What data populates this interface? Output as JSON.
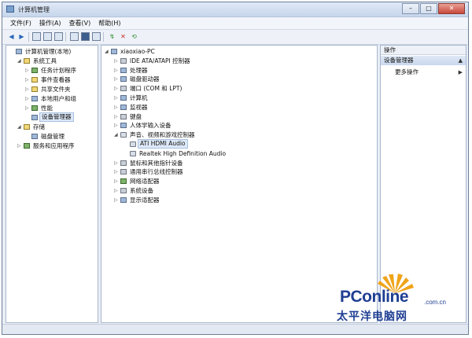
{
  "window": {
    "title": "计算机管理",
    "buttons": {
      "minimize": "–",
      "maximize": "□",
      "close": "✕"
    }
  },
  "menu": [
    "文件(F)",
    "操作(A)",
    "查看(V)",
    "帮助(H)"
  ],
  "left_tree": {
    "items": [
      {
        "label": "计算机管理(本地)",
        "depth": 0,
        "twisty": "",
        "icon": "computer-icon"
      },
      {
        "label": "系统工具",
        "depth": 1,
        "twisty": "◢",
        "icon": "tools-icon"
      },
      {
        "label": "任务计划程序",
        "depth": 2,
        "twisty": "▷",
        "icon": "clock-icon"
      },
      {
        "label": "事件查看器",
        "depth": 2,
        "twisty": "▷",
        "icon": "log-icon"
      },
      {
        "label": "共享文件夹",
        "depth": 2,
        "twisty": "▷",
        "icon": "folder-icon"
      },
      {
        "label": "本地用户和组",
        "depth": 2,
        "twisty": "▷",
        "icon": "users-icon"
      },
      {
        "label": "性能",
        "depth": 2,
        "twisty": "▷",
        "icon": "performance-icon"
      },
      {
        "label": "设备管理器",
        "depth": 2,
        "twisty": "",
        "icon": "device-manager-icon",
        "selected": true
      },
      {
        "label": "存储",
        "depth": 1,
        "twisty": "◢",
        "icon": "storage-icon"
      },
      {
        "label": "磁盘管理",
        "depth": 2,
        "twisty": "",
        "icon": "disk-icon"
      },
      {
        "label": "服务和应用程序",
        "depth": 1,
        "twisty": "▷",
        "icon": "services-icon"
      }
    ]
  },
  "device_tree": {
    "items": [
      {
        "label": "xiaoxiao-PC",
        "depth": 0,
        "twisty": "◢",
        "icon": "computer-icon"
      },
      {
        "label": "IDE ATA/ATAPI 控制器",
        "depth": 1,
        "twisty": "▷",
        "icon": "ide-icon"
      },
      {
        "label": "处理器",
        "depth": 1,
        "twisty": "▷",
        "icon": "processor-icon"
      },
      {
        "label": "磁盘驱动器",
        "depth": 1,
        "twisty": "▷",
        "icon": "disk-drive-icon"
      },
      {
        "label": "端口 (COM 和 LPT)",
        "depth": 1,
        "twisty": "▷",
        "icon": "port-icon"
      },
      {
        "label": "计算机",
        "depth": 1,
        "twisty": "▷",
        "icon": "computer-icon"
      },
      {
        "label": "监视器",
        "depth": 1,
        "twisty": "▷",
        "icon": "monitor-icon"
      },
      {
        "label": "键盘",
        "depth": 1,
        "twisty": "▷",
        "icon": "keyboard-icon"
      },
      {
        "label": "人体学输入设备",
        "depth": 1,
        "twisty": "▷",
        "icon": "hid-icon"
      },
      {
        "label": "声音、视频和游戏控制器",
        "depth": 1,
        "twisty": "◢",
        "icon": "sound-icon"
      },
      {
        "label": "ATI HDMI Audio",
        "depth": 2,
        "twisty": "",
        "icon": "speaker-icon",
        "selected": true
      },
      {
        "label": "Realtek High Definition Audio",
        "depth": 2,
        "twisty": "",
        "icon": "speaker-icon"
      },
      {
        "label": "鼠标和其他指针设备",
        "depth": 1,
        "twisty": "▷",
        "icon": "mouse-icon"
      },
      {
        "label": "通用串行总线控制器",
        "depth": 1,
        "twisty": "▷",
        "icon": "usb-icon"
      },
      {
        "label": "网络适配器",
        "depth": 1,
        "twisty": "▷",
        "icon": "network-icon"
      },
      {
        "label": "系统设备",
        "depth": 1,
        "twisty": "▷",
        "icon": "system-device-icon"
      },
      {
        "label": "显示适配器",
        "depth": 1,
        "twisty": "▷",
        "icon": "display-adapter-icon"
      }
    ]
  },
  "actions": {
    "header": "操作",
    "section": "设备管理器",
    "more": "更多操作",
    "caret_up": "▲",
    "caret_right": "▶"
  },
  "watermark": {
    "brand": "PConline",
    "domain": ".com.cn",
    "chinese": "太平洋电脑网"
  }
}
